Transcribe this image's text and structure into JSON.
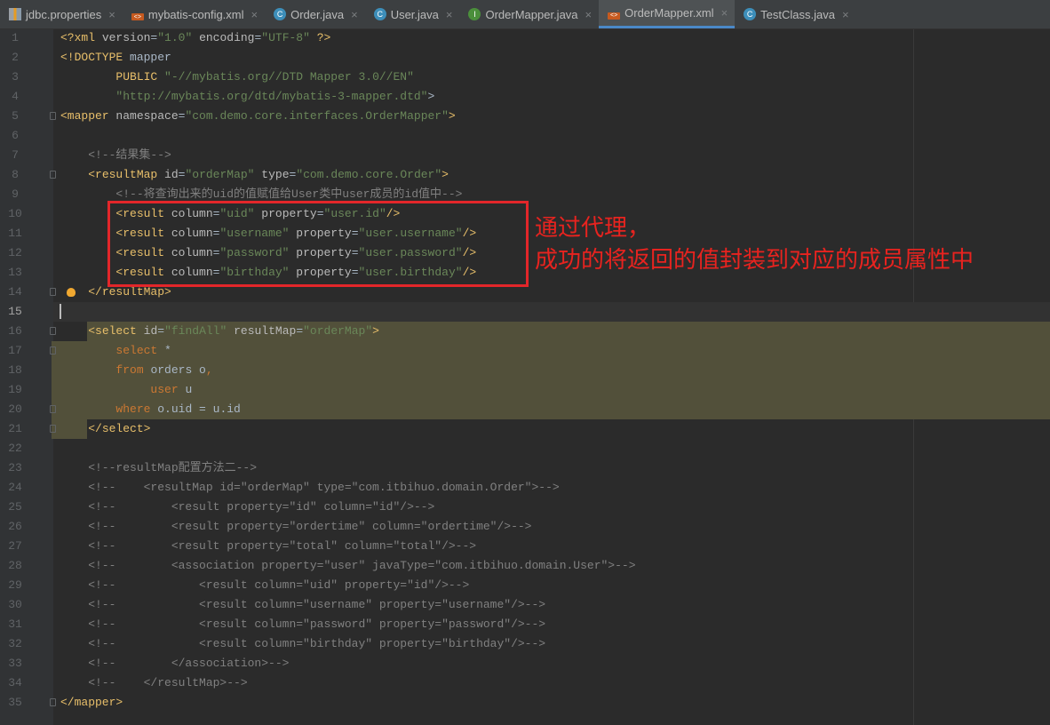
{
  "tabs": [
    {
      "label": "jdbc.properties",
      "icon": "properties-file-icon",
      "active": false
    },
    {
      "label": "mybatis-config.xml",
      "icon": "xml-file-icon",
      "active": false
    },
    {
      "label": "Order.java",
      "icon": "class-icon",
      "active": false
    },
    {
      "label": "User.java",
      "icon": "class-icon",
      "active": false
    },
    {
      "label": "OrderMapper.java",
      "icon": "interface-icon",
      "active": false
    },
    {
      "label": "OrderMapper.xml",
      "icon": "xml-file-icon",
      "active": true
    },
    {
      "label": "TestClass.java",
      "icon": "test-class-icon",
      "active": false
    }
  ],
  "annotation": {
    "line1": "通过代理，",
    "line2": "成功的将返回的值封装到对应的成员属性中"
  },
  "current_line": 15,
  "lines": [
    [
      [
        "tg",
        "<?xml "
      ],
      [
        "at",
        "version"
      ],
      [
        "tx",
        "="
      ],
      [
        "st",
        "\"1.0\""
      ],
      [
        "tx",
        " "
      ],
      [
        "at",
        "encoding"
      ],
      [
        "tx",
        "="
      ],
      [
        "st",
        "\"UTF-8\""
      ],
      [
        "tg",
        " ?>"
      ]
    ],
    [
      [
        "tg",
        "<!DOCTYPE "
      ],
      [
        "tx",
        "mapper"
      ]
    ],
    [
      [
        "tx",
        "        "
      ],
      [
        "tg",
        "PUBLIC "
      ],
      [
        "st",
        "\"-//mybatis.org//DTD Mapper 3.0//EN\""
      ]
    ],
    [
      [
        "tx",
        "        "
      ],
      [
        "st",
        "\"http://mybatis.org/dtd/mybatis-3-mapper.dtd\""
      ],
      [
        "tx",
        ">"
      ]
    ],
    [
      [
        "tg",
        "<mapper "
      ],
      [
        "at",
        "namespace"
      ],
      [
        "tx",
        "="
      ],
      [
        "st",
        "\"com.demo.core.interfaces.OrderMapper\""
      ],
      [
        "tg",
        ">"
      ]
    ],
    [],
    [
      [
        "cm",
        "    <!--结果集-->"
      ]
    ],
    [
      [
        "tx",
        "    "
      ],
      [
        "tg",
        "<resultMap "
      ],
      [
        "at",
        "id"
      ],
      [
        "tx",
        "="
      ],
      [
        "st",
        "\"orderMap\""
      ],
      [
        "tx",
        " "
      ],
      [
        "at",
        "type"
      ],
      [
        "tx",
        "="
      ],
      [
        "st",
        "\"com.demo.core.Order\""
      ],
      [
        "tg",
        ">"
      ]
    ],
    [
      [
        "cm",
        "        <!--将查询出来的uid的值赋值给User类中user成员的id值中-->"
      ]
    ],
    [
      [
        "tx",
        "        "
      ],
      [
        "tg",
        "<result "
      ],
      [
        "at",
        "column"
      ],
      [
        "tx",
        "="
      ],
      [
        "st",
        "\"uid\""
      ],
      [
        "tx",
        " "
      ],
      [
        "at",
        "property"
      ],
      [
        "tx",
        "="
      ],
      [
        "st",
        "\"user.id\""
      ],
      [
        "tg",
        "/>"
      ]
    ],
    [
      [
        "tx",
        "        "
      ],
      [
        "tg",
        "<result "
      ],
      [
        "at",
        "column"
      ],
      [
        "tx",
        "="
      ],
      [
        "st",
        "\"username\""
      ],
      [
        "tx",
        " "
      ],
      [
        "at",
        "property"
      ],
      [
        "tx",
        "="
      ],
      [
        "st",
        "\"user.username\""
      ],
      [
        "tg",
        "/>"
      ]
    ],
    [
      [
        "tx",
        "        "
      ],
      [
        "tg",
        "<result "
      ],
      [
        "at",
        "column"
      ],
      [
        "tx",
        "="
      ],
      [
        "st",
        "\"password\""
      ],
      [
        "tx",
        " "
      ],
      [
        "at",
        "property"
      ],
      [
        "tx",
        "="
      ],
      [
        "st",
        "\"user.password\""
      ],
      [
        "tg",
        "/>"
      ]
    ],
    [
      [
        "tx",
        "        "
      ],
      [
        "tg",
        "<result "
      ],
      [
        "at",
        "column"
      ],
      [
        "tx",
        "="
      ],
      [
        "st",
        "\"birthday\""
      ],
      [
        "tx",
        " "
      ],
      [
        "at",
        "property"
      ],
      [
        "tx",
        "="
      ],
      [
        "st",
        "\"user.birthday\""
      ],
      [
        "tg",
        "/>"
      ]
    ],
    [
      [
        "tx",
        "    "
      ],
      [
        "tg",
        "</resultMap>"
      ]
    ],
    [],
    [
      [
        "tx",
        "    "
      ],
      [
        "tg",
        "<select "
      ],
      [
        "at",
        "id"
      ],
      [
        "tx",
        "="
      ],
      [
        "st",
        "\"findAll\""
      ],
      [
        "tx",
        " "
      ],
      [
        "at",
        "resultMap"
      ],
      [
        "tx",
        "="
      ],
      [
        "st",
        "\"orderMap\""
      ],
      [
        "tg",
        ">"
      ]
    ],
    [
      [
        "tx",
        "        "
      ],
      [
        "kw",
        "select "
      ],
      [
        "tx",
        "*"
      ]
    ],
    [
      [
        "tx",
        "        "
      ],
      [
        "kw",
        "from "
      ],
      [
        "tx",
        "orders o"
      ],
      [
        "kw",
        ","
      ]
    ],
    [
      [
        "tx",
        "             "
      ],
      [
        "kw",
        "user "
      ],
      [
        "tx",
        "u"
      ]
    ],
    [
      [
        "tx",
        "        "
      ],
      [
        "kw",
        "where "
      ],
      [
        "tx",
        "o.uid = u.id"
      ]
    ],
    [
      [
        "tx",
        "    "
      ],
      [
        "tg",
        "</select>"
      ]
    ],
    [],
    [
      [
        "cm",
        "    <!--resultMap配置方法二-->"
      ]
    ],
    [
      [
        "cm",
        "    <!--    <resultMap id=\"orderMap\" type=\"com.itbihuo.domain.Order\">-->"
      ]
    ],
    [
      [
        "cm",
        "    <!--        <result property=\"id\" column=\"id\"/>-->"
      ]
    ],
    [
      [
        "cm",
        "    <!--        <result property=\"ordertime\" column=\"ordertime\"/>-->"
      ]
    ],
    [
      [
        "cm",
        "    <!--        <result property=\"total\" column=\"total\"/>-->"
      ]
    ],
    [
      [
        "cm",
        "    <!--        <association property=\"user\" javaType=\"com.itbihuo.domain.User\">-->"
      ]
    ],
    [
      [
        "cm",
        "    <!--            <result column=\"uid\" property=\"id\"/>-->"
      ]
    ],
    [
      [
        "cm",
        "    <!--            <result column=\"username\" property=\"username\"/>-->"
      ]
    ],
    [
      [
        "cm",
        "    <!--            <result column=\"password\" property=\"password\"/>-->"
      ]
    ],
    [
      [
        "cm",
        "    <!--            <result column=\"birthday\" property=\"birthday\"/>-->"
      ]
    ],
    [
      [
        "cm",
        "    <!--        </association>-->"
      ]
    ],
    [
      [
        "cm",
        "    <!--    </resultMap>-->"
      ]
    ],
    [
      [
        "tg",
        "</mapper>"
      ]
    ]
  ]
}
